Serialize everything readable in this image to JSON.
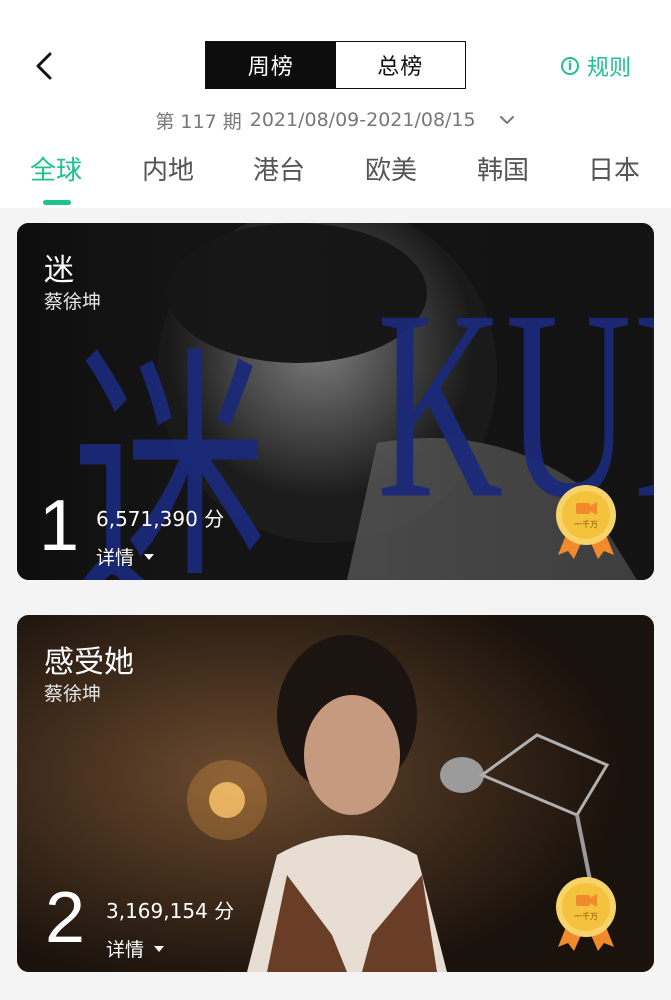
{
  "header": {
    "tabs": [
      {
        "label": "周榜",
        "active": true
      },
      {
        "label": "总榜",
        "active": false
      }
    ],
    "rules_label": "规则",
    "rules_icon": "info-icon",
    "back_icon": "chevron-left-icon"
  },
  "period": {
    "issue": "第 117 期",
    "range": "2021/08/09-2021/08/15",
    "dropdown_icon": "chevron-down-icon"
  },
  "regions": [
    "全球",
    "内地",
    "港台",
    "欧美",
    "韩国",
    "日本"
  ],
  "active_region": "全球",
  "colors": {
    "accent": "#1ec28b",
    "badge_gold": "#f5c23e",
    "badge_ribbon": "#f08a2c",
    "poster_text": "#1b2a7a"
  },
  "cards": [
    {
      "title": "迷",
      "artist": "蔡徐坤",
      "rank": "1",
      "score": "6,571,390 分",
      "detail": "详情",
      "badge_text": "一千万",
      "badge_icon": "video-camera-icon",
      "poster_text": [
        "迷",
        "KUN"
      ]
    },
    {
      "title": "感受她",
      "artist": "蔡徐坤",
      "rank": "2",
      "score": "3,169,154 分",
      "detail": "详情",
      "badge_text": "一千万",
      "badge_icon": "video-camera-icon"
    }
  ]
}
